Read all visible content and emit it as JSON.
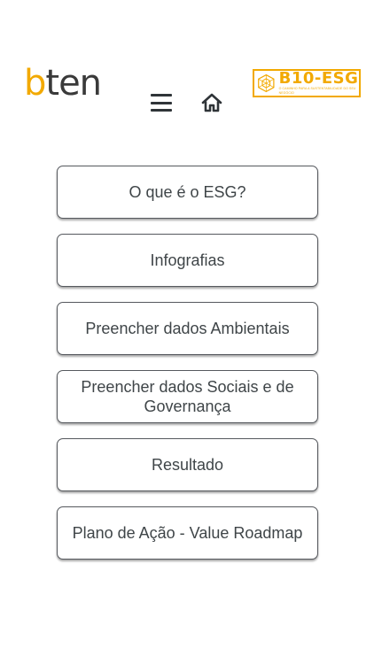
{
  "header": {
    "logo_left": {
      "prefix": "b",
      "rest": "ten"
    },
    "logo_right": {
      "brand": "B10-ESG",
      "tagline": "O CAMINHO PARA A SUSTENTABILIDADE DO SEU NEGÓCIO"
    },
    "menu_icon": "hamburger-icon",
    "home_icon": "home-icon"
  },
  "colors": {
    "accent": "#f2a900",
    "text": "#3f4548",
    "border": "#56595e"
  },
  "menu": {
    "items": [
      {
        "label": "O que é o ESG?"
      },
      {
        "label": "Infografias"
      },
      {
        "label": "Preencher dados Ambientais"
      },
      {
        "label": "Preencher dados Sociais e de Governança"
      },
      {
        "label": "Resultado"
      },
      {
        "label": "Plano de Ação - Value Roadmap"
      }
    ]
  }
}
